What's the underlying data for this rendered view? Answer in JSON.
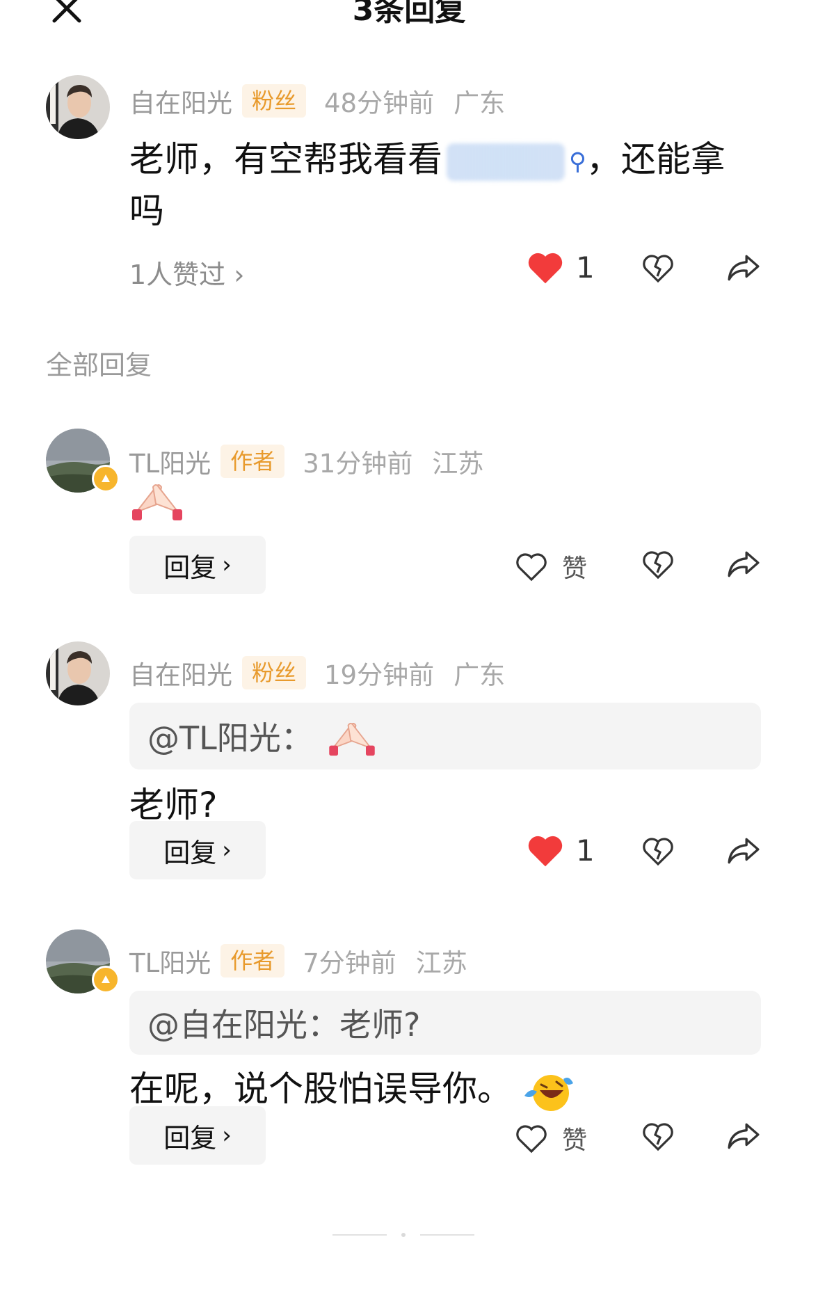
{
  "header": {
    "title": "3条回复",
    "close_icon": "close-icon"
  },
  "main_comment": {
    "username": "自在阳光",
    "tag": "粉丝",
    "time": "48分钟前",
    "location": "广东",
    "text_before": "老师，有空帮我看看",
    "text_after": "，还能拿",
    "text_line2": "吗",
    "likers": "1人赞过 ›",
    "like_count": "1"
  },
  "section": {
    "label": "全部回复"
  },
  "replies": [
    {
      "username": "TL阳光",
      "tag": "作者",
      "time": "31分钟前",
      "location": "江苏",
      "emoji": "praying-hands-emoji",
      "reply_label": "回复",
      "like_label": "赞"
    },
    {
      "username": "自在阳光",
      "tag": "粉丝",
      "time": "19分钟前",
      "location": "广东",
      "quote": "@TL阳光：",
      "text": "老师?",
      "reply_label": "回复",
      "like_count": "1"
    },
    {
      "username": "TL阳光",
      "tag": "作者",
      "time": "7分钟前",
      "location": "江苏",
      "quote": "@自在阳光：老师?",
      "text": "在呢，说个股怕误导你。",
      "reply_label": "回复",
      "like_label": "赞"
    }
  ],
  "colors": {
    "heart_red": "#f23b3b",
    "tag_bg": "#fdf3e6",
    "tag_text": "#e89a2c",
    "badge": "#f7b52c"
  }
}
